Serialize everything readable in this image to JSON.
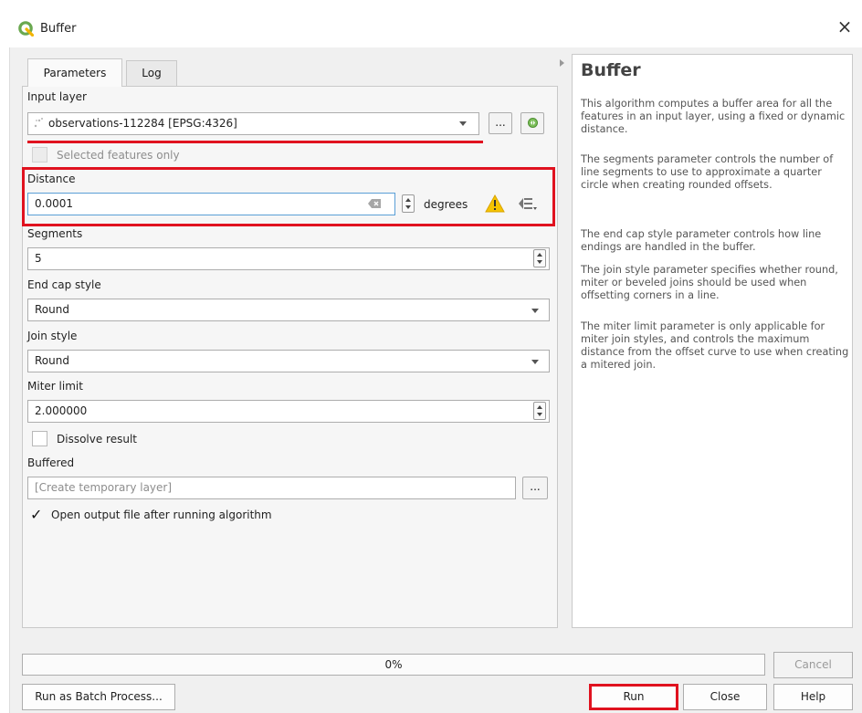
{
  "window": {
    "title": "Buffer",
    "close_glyph": "×"
  },
  "tabs": [
    {
      "label": "Parameters",
      "active": true
    },
    {
      "label": "Log",
      "active": false
    }
  ],
  "params": {
    "input_layer": {
      "label": "Input layer",
      "value": "observations-112284 [EPSG:4326]",
      "browse_label": "..."
    },
    "selected_only": {
      "label": "Selected features only",
      "checked": false,
      "enabled": false
    },
    "distance": {
      "label": "Distance",
      "value": "0.0001",
      "unit": "degrees"
    },
    "segments": {
      "label": "Segments",
      "value": "5"
    },
    "end_cap": {
      "label": "End cap style",
      "value": "Round"
    },
    "join": {
      "label": "Join style",
      "value": "Round"
    },
    "miter": {
      "label": "Miter limit",
      "value": "2.000000"
    },
    "dissolve": {
      "label": "Dissolve result",
      "checked": false
    },
    "output": {
      "label": "Buffered",
      "placeholder": "[Create temporary layer]",
      "browse_label": "..."
    },
    "open_output": {
      "label": "Open output file after running algorithm",
      "checked": true,
      "check_glyph": "✓"
    }
  },
  "help": {
    "title": "Buffer",
    "paragraphs": [
      "This algorithm computes a buffer area for all the features in an input layer, using a fixed or dynamic distance.",
      "The segments parameter controls the number of line segments to use to approximate a quarter circle when creating rounded offsets.",
      "The end cap style parameter controls how line endings are handled in the buffer.",
      "The join style parameter specifies whether round, miter or beveled joins should be used when offsetting corners in a line.",
      "The miter limit parameter is only applicable for miter join styles, and controls the maximum distance from the offset curve to use when creating a mitered join."
    ]
  },
  "progress": {
    "text": "0%",
    "value": 0
  },
  "buttons": {
    "cancel": "Cancel",
    "batch": "Run as Batch Process...",
    "run": "Run",
    "close": "Close",
    "help": "Help"
  },
  "colors": {
    "highlight_red": "#e0121f",
    "qgis_green": "#6aa84f",
    "warning_yellow": "#f5c400"
  },
  "icons": {
    "app": "qgis-logo-icon",
    "layer_type": "point-layer-icon",
    "iterate": "iterate-icon",
    "clear": "clear-icon",
    "warning": "warning-icon",
    "data_defined": "data-defined-override-icon"
  }
}
